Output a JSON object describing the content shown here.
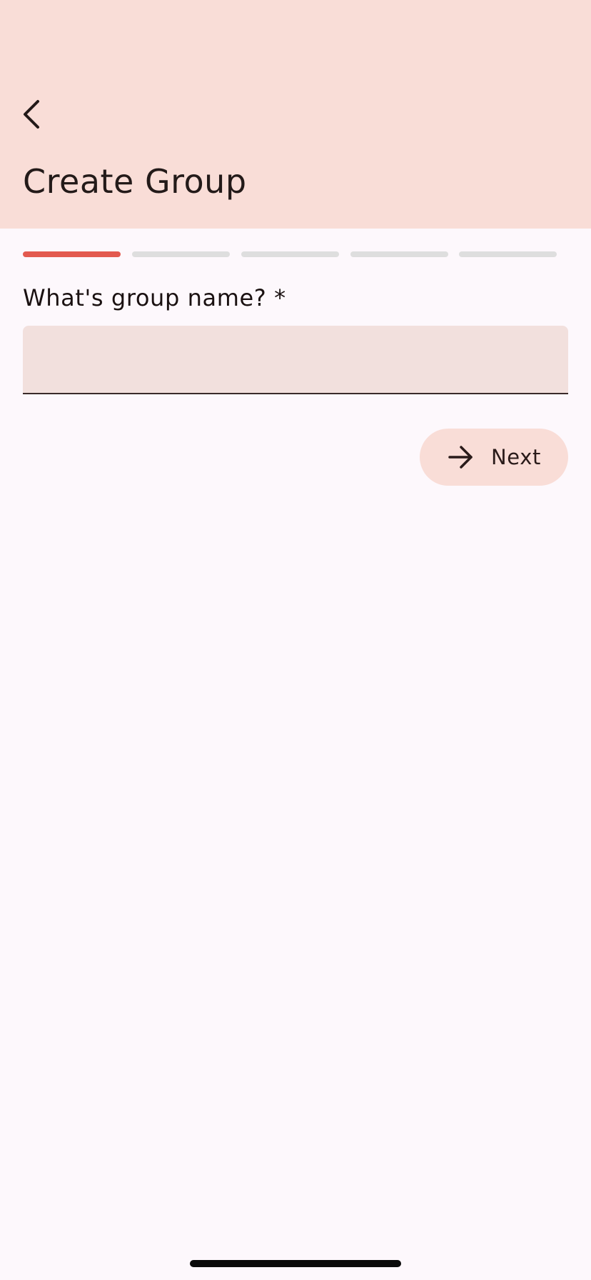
{
  "app_bar": {
    "back_icon": "chevron-left-icon",
    "title": "Create Group"
  },
  "progress": {
    "total_steps": 5,
    "current_step": 1,
    "active_color": "#e35a4f",
    "inactive_color": "#dedede"
  },
  "form": {
    "group_name_label": "What's group name? *",
    "group_name_value": "",
    "group_name_placeholder": ""
  },
  "actions": {
    "next_icon": "arrow-right-icon",
    "next_label": "Next"
  },
  "colors": {
    "header_bg": "#f9ddd7",
    "page_bg": "#fdf8fc",
    "field_bg": "#f2e0dd",
    "accent": "#e35a4f"
  }
}
